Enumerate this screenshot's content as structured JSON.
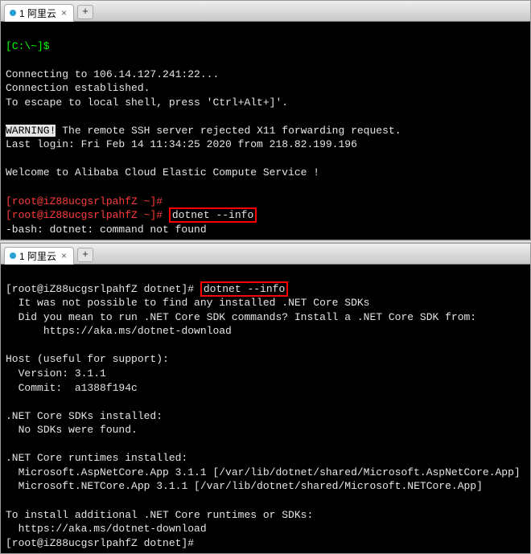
{
  "window1": {
    "tab": {
      "label": "1 阿里云"
    },
    "prompt_header": "[C:\\~]$",
    "lines": {
      "connecting": "Connecting to 106.14.127.241:22...",
      "established": "Connection established.",
      "escape": "To escape to local shell, press 'Ctrl+Alt+]'.",
      "warning": "WARNING!",
      "warning_rest": " The remote SSH server rejected X11 forwarding request.",
      "last_login": "Last login: Fri Feb 14 11:34:25 2020 from 218.82.199.196",
      "welcome": "Welcome to Alibaba Cloud Elastic Compute Service !",
      "prompt1": "[root@iZ88ucgsrlpahfZ ~]# ",
      "prompt2": "[root@iZ88ucgsrlpahfZ ~]# ",
      "command": "dotnet --info",
      "bash_err": "-bash: dotnet: command not found"
    }
  },
  "window2": {
    "tab": {
      "label": "1 阿里云"
    },
    "lines": {
      "prompt1": "[root@iZ88ucgsrlpahfZ dotnet]# ",
      "command": "dotnet --info",
      "err1": "  It was not possible to find any installed .NET Core SDKs",
      "err2": "  Did you mean to run .NET Core SDK commands? Install a .NET Core SDK from:",
      "err3": "      https://aka.ms/dotnet-download",
      "host_header": "Host (useful for support):",
      "version": "  Version: 3.1.1",
      "commit": "  Commit:  a1388f194c",
      "sdks_header": ".NET Core SDKs installed:",
      "sdks_none": "  No SDKs were found.",
      "runtimes_header": ".NET Core runtimes installed:",
      "runtime1": "  Microsoft.AspNetCore.App 3.1.1 [/var/lib/dotnet/shared/Microsoft.AspNetCore.App]",
      "runtime2": "  Microsoft.NETCore.App 3.1.1 [/var/lib/dotnet/shared/Microsoft.NETCore.App]",
      "install_header": "To install additional .NET Core runtimes or SDKs:",
      "install_url": "  https://aka.ms/dotnet-download",
      "prompt2": "[root@iZ88ucgsrlpahfZ dotnet]#"
    }
  }
}
